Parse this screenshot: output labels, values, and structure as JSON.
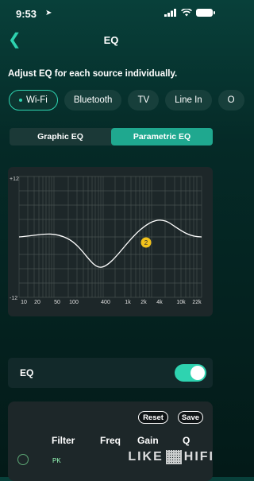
{
  "status_bar": {
    "time": "9:53"
  },
  "nav": {
    "title": "EQ"
  },
  "subtitle": "Adjust EQ for each source individually.",
  "sources": [
    {
      "label": "Wi-Fi",
      "active": true
    },
    {
      "label": "Bluetooth",
      "active": false
    },
    {
      "label": "TV",
      "active": false
    },
    {
      "label": "Line In",
      "active": false
    },
    {
      "label": "O",
      "active": false
    }
  ],
  "modes": [
    {
      "label": "Graphic EQ",
      "active": false
    },
    {
      "label": "Parametric EQ",
      "active": true
    }
  ],
  "graph": {
    "y_top": "+12",
    "y_bottom": "-12",
    "x_ticks": [
      "10",
      "20",
      "50",
      "100",
      "400",
      "1k",
      "2k",
      "4k",
      "10k",
      "22k"
    ],
    "band_marker": "2"
  },
  "eq_toggle": {
    "label": "EQ",
    "on": true
  },
  "table": {
    "reset_label": "Reset",
    "save_label": "Save",
    "headers": [
      "Filter",
      "Freq",
      "Gain",
      "Q"
    ],
    "row_partial": "PK"
  },
  "watermark": {
    "left": "LIKE",
    "right": "HIFI"
  },
  "colors": {
    "accent": "#2ed3b0",
    "active_mode": "#1fa88f",
    "marker": "#f2c21b"
  }
}
